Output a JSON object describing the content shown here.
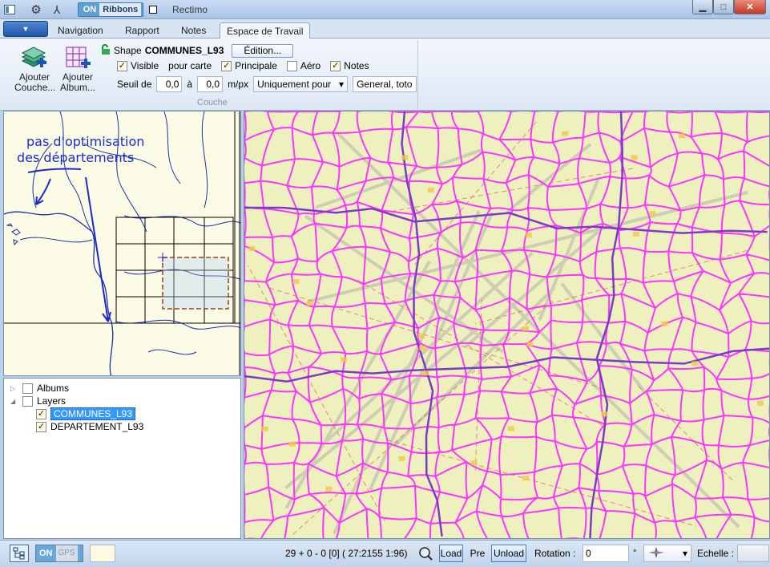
{
  "window": {
    "title": "Rectimo",
    "ribbons_toggle": {
      "state": "ON",
      "label": "Ribbons"
    },
    "controls": {
      "minimize": "▁",
      "maximize": "□",
      "close": "✕"
    }
  },
  "tabs": [
    {
      "label": "Navigation"
    },
    {
      "label": "Rapport"
    },
    {
      "label": "Notes"
    },
    {
      "label": "Espace de Travail",
      "active": true
    }
  ],
  "ribbon": {
    "buttons": {
      "add_layer": "Ajouter Couche...",
      "add_album": "Ajouter Album..."
    },
    "shape_label": "Shape",
    "shape_name": "COMMUNES_L93",
    "edition_button": "Édition...",
    "checks": [
      {
        "label": "Visible",
        "checked": true
      },
      {
        "label": "pour carte",
        "checked": null
      },
      {
        "label": "Principale",
        "checked": true
      },
      {
        "label": "Aéro",
        "checked": false
      },
      {
        "label": "Notes",
        "checked": true
      }
    ],
    "seuil_label": "Seuil de",
    "seuil_from": "0,0",
    "seuil_to_label": "à",
    "seuil_to": "0,0",
    "unit": "m/px",
    "mode_select": "Uniquement pour",
    "tags_field": "General, toto",
    "group_label": "Couche"
  },
  "overview_annotation": {
    "line1": "pas d'optimisation",
    "line2": "des départements"
  },
  "layer_tree": {
    "albums": {
      "label": "Albums",
      "checked": false
    },
    "layers": {
      "label": "Layers",
      "checked": false
    },
    "children": [
      {
        "label": "COMMUNES_L93",
        "checked": true,
        "selected": true
      },
      {
        "label": "DEPARTEMENT_L93",
        "checked": true,
        "selected": false
      }
    ]
  },
  "statusbar": {
    "gps_toggle": {
      "state": "ON",
      "label": "GPS"
    },
    "coords": "29 + 0 - 0 [0]  ( 27:2155  1:96)",
    "load": "Load",
    "pre": "Pre",
    "unload": "Unload",
    "rotation_label": "Rotation :",
    "rotation_value": "0",
    "degree": "°",
    "echelle_label": "Echelle :"
  },
  "colors": {
    "commune_lines": "#ff33ff",
    "departement_lines": "#7a3cc8",
    "annotation": "#1a2ad0",
    "map_background": "#eef0be"
  }
}
